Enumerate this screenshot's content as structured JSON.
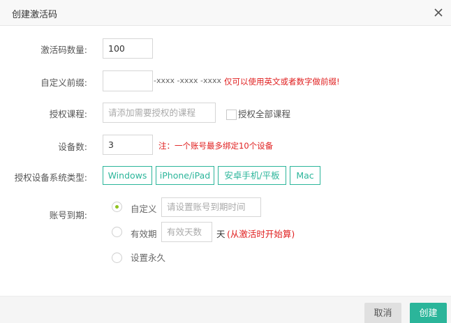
{
  "dialog": {
    "title": "创建激活码",
    "close_icon": "close-icon"
  },
  "form": {
    "quantity": {
      "label": "激活码数量:",
      "value": "100"
    },
    "prefix": {
      "label": "自定义前缀:",
      "value": "",
      "suffix_pattern": "-xxxx -xxxx -xxxx",
      "hint": "仅可以使用英文或者数字做前缀!"
    },
    "courses": {
      "label": "授权课程:",
      "placeholder": "请添加需要授权的课程",
      "all_label": "授权全部课程",
      "all_checked": false
    },
    "devices": {
      "label": "设备数:",
      "value": "3",
      "hint": "注：一个账号最多绑定10个设备"
    },
    "platforms": {
      "label": "授权设备系统类型:",
      "items": [
        "Windows",
        "iPhone/iPad",
        "安卓手机/平板",
        "Mac"
      ]
    },
    "expiry": {
      "label": "账号到期:",
      "options": {
        "custom": {
          "label": "自定义",
          "placeholder": "请设置账号到期时间",
          "selected": true
        },
        "duration": {
          "label": "有效期",
          "placeholder": "有效天数",
          "unit": "天",
          "note": "(从激活时开始算)",
          "selected": false
        },
        "forever": {
          "label": "设置永久",
          "selected": false
        }
      }
    }
  },
  "footer": {
    "cancel_label": "取消",
    "create_label": "创建"
  },
  "colors": {
    "accent": "#2bb59a",
    "radio_dot": "#90c31f",
    "warning": "#e02020"
  }
}
